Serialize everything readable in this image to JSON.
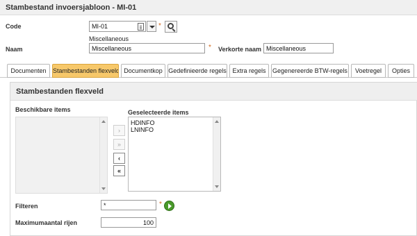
{
  "window": {
    "title": "Stambestand invoersjabloon - MI-01"
  },
  "form": {
    "code_label": "Code",
    "code_value": "MI-01",
    "code_caption": "Miscellaneous",
    "required_mark": "*",
    "naam_label": "Naam",
    "naam_value": "Miscellaneous",
    "verkorte_label": "Verkorte naam",
    "verkorte_value": "Miscellaneous"
  },
  "tabs": [
    {
      "label": "Documenten",
      "active": false
    },
    {
      "label": "Stambestanden flexveld",
      "active": true
    },
    {
      "label": "Documentkop",
      "active": false
    },
    {
      "label": "Gedefinieerde regels",
      "active": false
    },
    {
      "label": "Extra regels",
      "active": false
    },
    {
      "label": "Gegenereerde BTW-regels",
      "active": false
    },
    {
      "label": "Voetregel",
      "active": false
    },
    {
      "label": "Opties",
      "active": false
    }
  ],
  "panel": {
    "title": "Stambestanden flexveld",
    "available_label": "Beschikbare items",
    "available_items": [],
    "selected_label": "Geselecteerde items",
    "selected_items": [
      "HDINFO",
      "LNINFO"
    ],
    "buttons": {
      "add": "›",
      "add_all": "»",
      "remove": "‹",
      "remove_all": "«"
    },
    "filter_label": "Filteren",
    "filter_value": "*",
    "filter_required": "*",
    "max_rows_label": "Maximumaantal rijen",
    "max_rows_value": "100"
  },
  "icons": {
    "code_lookup": "document-icon",
    "dropdown": "chevron-down-icon",
    "search": "search-icon",
    "apply": "play-icon"
  },
  "colors": {
    "active_tab": "#f7c86a",
    "required": "#d2691e",
    "go_button": "#4a9a2a"
  }
}
